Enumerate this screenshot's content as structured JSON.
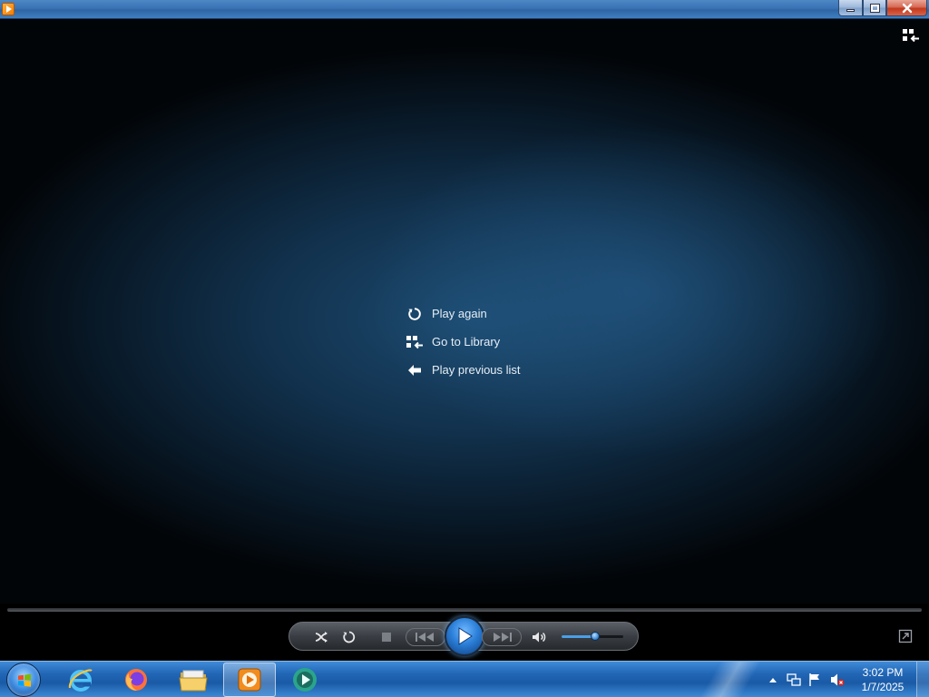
{
  "window": {
    "title": "",
    "controls": {
      "minimize": "minimize",
      "maximize": "restore",
      "close": "close"
    }
  },
  "now_playing": {
    "end_menu": [
      {
        "id": "play-again",
        "label": "Play again",
        "icon": "replay-icon"
      },
      {
        "id": "go-to-library",
        "label": "Go to Library",
        "icon": "library-icon"
      },
      {
        "id": "play-previous-list",
        "label": "Play previous list",
        "icon": "back-arrow-icon"
      }
    ]
  },
  "player_controls": {
    "shuffle": "shuffle-icon",
    "repeat": "repeat-icon",
    "stop": "stop-icon",
    "previous": "previous-icon",
    "play": "play-icon",
    "next": "next-icon",
    "mute": "speaker-icon",
    "volume_percent": 55,
    "seek_percent": 0
  },
  "taskbar": {
    "apps": [
      {
        "id": "ie",
        "icon": "internet-explorer-icon"
      },
      {
        "id": "firefox",
        "icon": "firefox-icon"
      },
      {
        "id": "explorer",
        "icon": "folder-icon"
      },
      {
        "id": "wmp",
        "icon": "windows-media-player-icon",
        "active": true
      },
      {
        "id": "wmc",
        "icon": "media-center-icon"
      }
    ],
    "tray": {
      "time": "3:02 PM",
      "date": "1/7/2025"
    }
  },
  "colors": {
    "accent": "#2b7fd8",
    "taskbar": "#2166b5",
    "video_bg": "#12324e"
  }
}
